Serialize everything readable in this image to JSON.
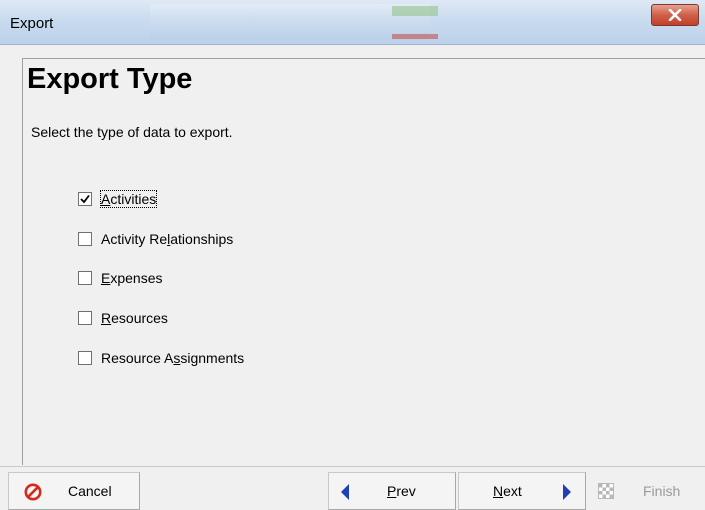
{
  "window": {
    "title": "Export"
  },
  "panel": {
    "title": "Export Type",
    "description": "Select the type of data to export."
  },
  "options": [
    {
      "pre": "",
      "u": "A",
      "post": "ctivities",
      "checked": true
    },
    {
      "pre": "Activity Re",
      "u": "l",
      "post": "ationships",
      "checked": false
    },
    {
      "pre": "",
      "u": "E",
      "post": "xpenses",
      "checked": false
    },
    {
      "pre": "",
      "u": "R",
      "post": "esources",
      "checked": false
    },
    {
      "pre": "Resource A",
      "u": "s",
      "post": "signments",
      "checked": false
    }
  ],
  "buttons": {
    "cancel": "Cancel",
    "prev_u": "P",
    "prev_rest": "rev",
    "next_u": "N",
    "next_rest": "ext",
    "finish": "Finish"
  },
  "icons": {
    "close": "close-icon",
    "cancel": "no-entry-icon",
    "prev": "arrow-left-icon",
    "next": "arrow-right-icon",
    "finish": "checkered-flag-icon"
  },
  "colors": {
    "cancel_icon": "#d42a1e",
    "arrow": "#1f3fb5",
    "close_button": "#c9452f"
  }
}
